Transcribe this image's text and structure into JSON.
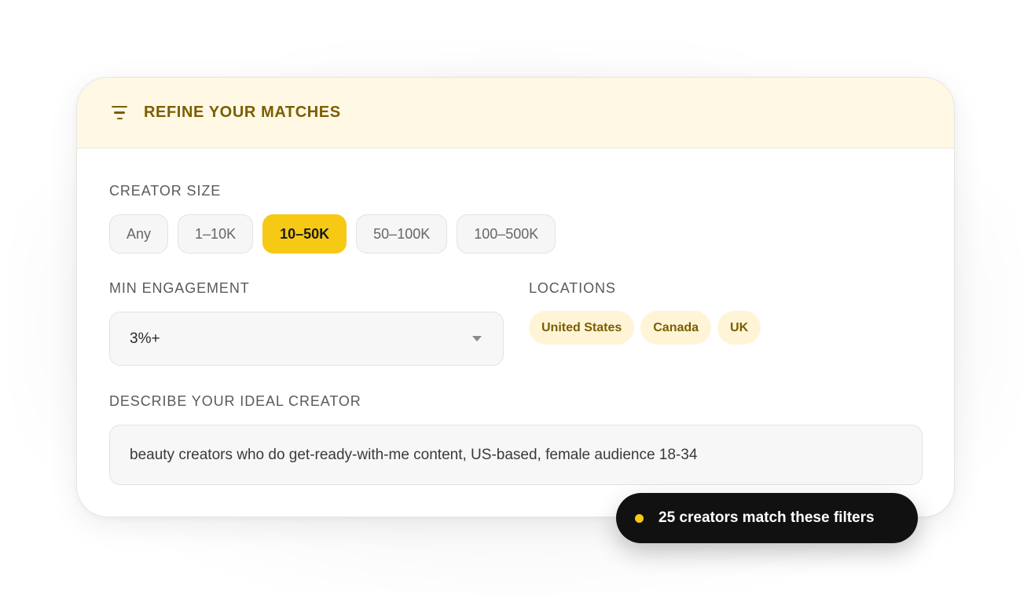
{
  "header": {
    "title": "REFINE YOUR MATCHES",
    "icon": "filter-icon"
  },
  "creator_size": {
    "label": "CREATOR SIZE",
    "options": [
      "Any",
      "1–10K",
      "10–50K",
      "50–100K",
      "100–500K"
    ],
    "selected": "10–50K"
  },
  "min_engagement": {
    "label": "MIN ENGAGEMENT",
    "value": "3%+"
  },
  "locations": {
    "label": "LOCATIONS",
    "items": [
      "United States",
      "Canada",
      "UK"
    ]
  },
  "ideal_creator": {
    "label": "DESCRIBE YOUR IDEAL CREATOR",
    "value": "beauty creators who do get-ready-with-me content, US-based, female audience 18-34"
  },
  "toast": {
    "text": "25 creators match these filters"
  },
  "colors": {
    "accent": "#f6c915",
    "header_bg": "#fff8e4",
    "header_text": "#7a5e00",
    "location_chip_bg": "#fff4d6",
    "toast_bg": "#111111"
  }
}
